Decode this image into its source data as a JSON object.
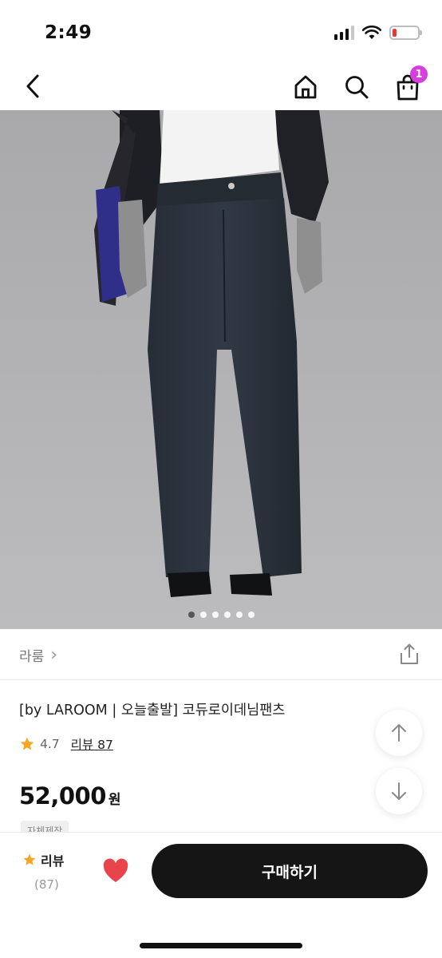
{
  "status_bar": {
    "time": "2:49",
    "battery_level": 0.15,
    "battery_color": "#e53935"
  },
  "nav": {
    "back_icon": "chevron-left-icon",
    "home_icon": "home-icon",
    "search_icon": "search-icon",
    "cart_icon": "shopping-bag-icon",
    "cart_badge": "1",
    "badge_color": "#d63ee0"
  },
  "gallery": {
    "image_count": 6,
    "active_index": 0
  },
  "brand": {
    "name": "라룸",
    "chevron": "›",
    "share_icon": "share-icon"
  },
  "product": {
    "title": "[by LAROOM | 오늘출발] 코듀로이데님팬츠",
    "rating": "4.7",
    "review_link": "리뷰 87",
    "price": "52,000",
    "currency": "원",
    "tag": "자체제작"
  },
  "bottom_bar": {
    "review_label": "리뷰",
    "review_count": "(87)",
    "buy_label": "구매하기",
    "heart_color": "#e8444b",
    "star_color": "#f5a623"
  }
}
